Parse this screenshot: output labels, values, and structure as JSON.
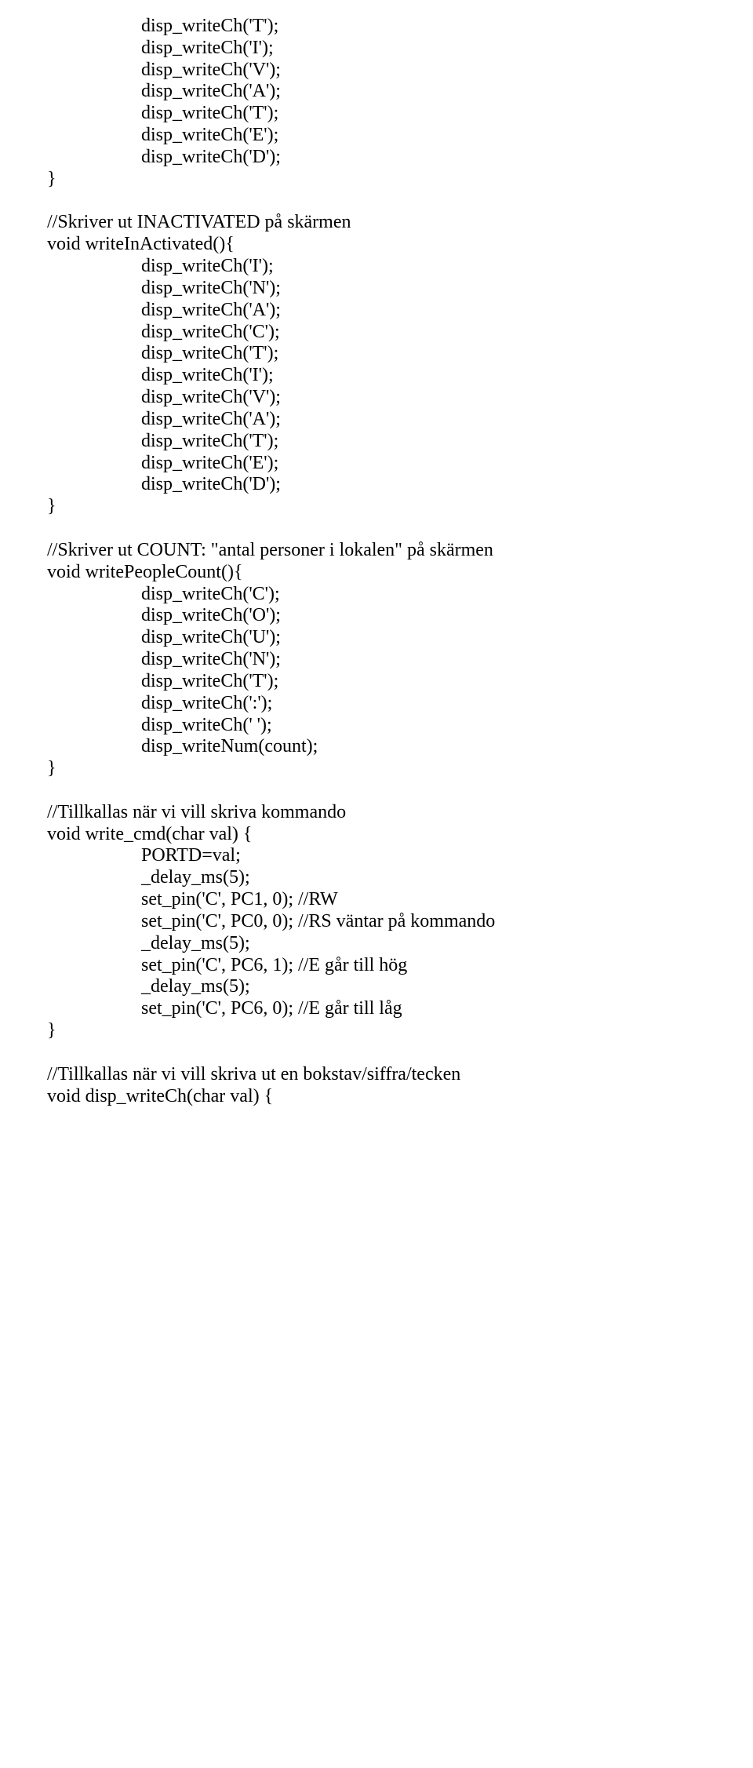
{
  "lines": [
    {
      "indent": 1,
      "text": "disp_writeCh('T');"
    },
    {
      "indent": 1,
      "text": "disp_writeCh('I');"
    },
    {
      "indent": 1,
      "text": "disp_writeCh('V');"
    },
    {
      "indent": 1,
      "text": "disp_writeCh('A');"
    },
    {
      "indent": 1,
      "text": "disp_writeCh('T');"
    },
    {
      "indent": 1,
      "text": "disp_writeCh('E');"
    },
    {
      "indent": 1,
      "text": "disp_writeCh('D');"
    },
    {
      "indent": 0,
      "text": "}"
    },
    {
      "indent": 0,
      "text": ""
    },
    {
      "indent": 0,
      "text": "//Skriver ut INACTIVATED på skärmen"
    },
    {
      "indent": 0,
      "text": "void writeInActivated(){"
    },
    {
      "indent": 1,
      "text": "disp_writeCh('I');"
    },
    {
      "indent": 1,
      "text": "disp_writeCh('N');"
    },
    {
      "indent": 1,
      "text": "disp_writeCh('A');"
    },
    {
      "indent": 1,
      "text": "disp_writeCh('C');"
    },
    {
      "indent": 1,
      "text": "disp_writeCh('T');"
    },
    {
      "indent": 1,
      "text": "disp_writeCh('I');"
    },
    {
      "indent": 1,
      "text": "disp_writeCh('V');"
    },
    {
      "indent": 1,
      "text": "disp_writeCh('A');"
    },
    {
      "indent": 1,
      "text": "disp_writeCh('T');"
    },
    {
      "indent": 1,
      "text": "disp_writeCh('E');"
    },
    {
      "indent": 1,
      "text": "disp_writeCh('D');"
    },
    {
      "indent": 0,
      "text": "}"
    },
    {
      "indent": 0,
      "text": ""
    },
    {
      "indent": 0,
      "text": "//Skriver ut COUNT: \"antal personer i lokalen\" på skärmen"
    },
    {
      "indent": 0,
      "text": "void writePeopleCount(){"
    },
    {
      "indent": 1,
      "text": "disp_writeCh('C');"
    },
    {
      "indent": 1,
      "text": "disp_writeCh('O');"
    },
    {
      "indent": 1,
      "text": "disp_writeCh('U');"
    },
    {
      "indent": 1,
      "text": "disp_writeCh('N');"
    },
    {
      "indent": 1,
      "text": "disp_writeCh('T');"
    },
    {
      "indent": 1,
      "text": "disp_writeCh(':');"
    },
    {
      "indent": 1,
      "text": "disp_writeCh(' ');"
    },
    {
      "indent": 1,
      "text": "disp_writeNum(count);"
    },
    {
      "indent": 0,
      "text": "}"
    },
    {
      "indent": 0,
      "text": ""
    },
    {
      "indent": 0,
      "text": "//Tillkallas när vi vill skriva kommando"
    },
    {
      "indent": 0,
      "text": "void write_cmd(char val) {"
    },
    {
      "indent": 1,
      "text": "PORTD=val;"
    },
    {
      "indent": 1,
      "text": "_delay_ms(5);"
    },
    {
      "indent": 1,
      "text": "set_pin('C', PC1, 0); //RW"
    },
    {
      "indent": 1,
      "text": "set_pin('C', PC0, 0); //RS väntar på kommando"
    },
    {
      "indent": 1,
      "text": "_delay_ms(5);"
    },
    {
      "indent": 1,
      "text": "set_pin('C', PC6, 1); //E går till hög"
    },
    {
      "indent": 1,
      "text": "_delay_ms(5);"
    },
    {
      "indent": 1,
      "text": "set_pin('C', PC6, 0); //E går till låg"
    },
    {
      "indent": 0,
      "text": "}"
    },
    {
      "indent": 0,
      "text": ""
    },
    {
      "indent": 0,
      "text": "//Tillkallas när vi vill skriva ut en bokstav/siffra/tecken"
    },
    {
      "indent": 0,
      "text": "void disp_writeCh(char val) {"
    }
  ]
}
